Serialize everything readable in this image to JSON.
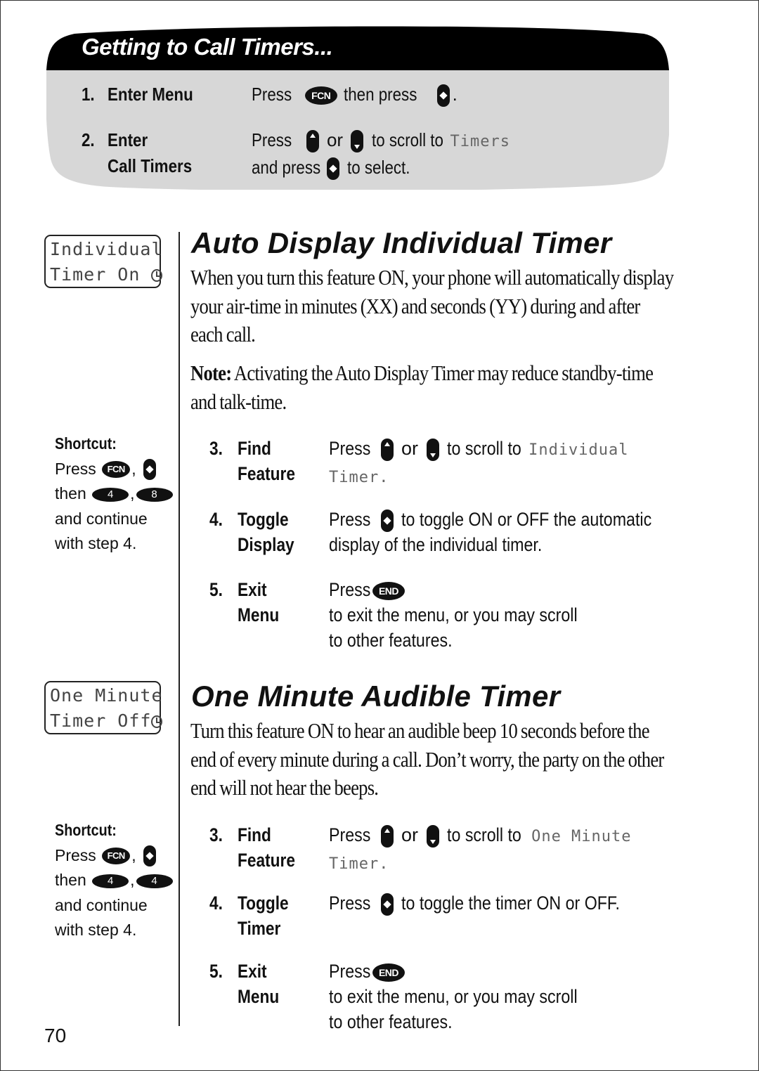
{
  "header": {
    "title": "Getting to Call Timers...",
    "steps": [
      {
        "number": "1.",
        "label": "Enter Menu",
        "desc_parts": [
          "Press",
          "then press",
          "."
        ],
        "keys": [
          "FCN",
          "select"
        ]
      },
      {
        "number": "2.",
        "label_line1": "Enter",
        "label_line2": "Call Timers",
        "line1_parts": [
          "Press",
          "or",
          "to scroll to"
        ],
        "line1_lcd": "Timers",
        "line2_parts": [
          "and press",
          "to select."
        ]
      }
    ]
  },
  "section1": {
    "title": "Auto Display Individual Timer",
    "lcd_line1": "Individual",
    "lcd_line2": "Timer On",
    "lcd_icon": "clock-icon",
    "intro": "When you turn this feature ON, your phone will automatically display your air-time in minutes (XX) and seconds (YY) during and after each call.",
    "note_label": "Note:",
    "note_text": " Activating the Auto Display Timer may reduce standby-time and talk-time.",
    "shortcut": {
      "title": "Shortcut:",
      "press": "Press",
      "comma": ",",
      "then": "then",
      "fcn_key": "FCN",
      "num_keys": [
        "4",
        "8"
      ],
      "line3": "and continue",
      "line4": "with step 4."
    },
    "steps": [
      {
        "number": "3.",
        "label_line1": "Find",
        "label_line2": "Feature",
        "parts": [
          "Press",
          "or",
          "to scroll to"
        ],
        "lcd_a": "Individual",
        "lcd_b": "Timer."
      },
      {
        "number": "4.",
        "label_line1": "Toggle",
        "label_line2": "Display",
        "parts": [
          "Press",
          "to toggle ON or OFF the automatic"
        ],
        "line2": "display of the individual timer."
      },
      {
        "number": "5.",
        "label_line1": "Exit",
        "label_line2": "Menu",
        "parts": [
          "Press",
          "to exit the menu, or you may scroll"
        ],
        "key": "END",
        "line2": "to other features."
      }
    ]
  },
  "section2": {
    "title": "One Minute Audible Timer",
    "lcd_line1": "One Minute",
    "lcd_line2": "Timer Off",
    "lcd_icon": "clock-icon",
    "intro": "Turn this feature ON to hear an audible beep 10 seconds before the end of every minute during a call. Don’t worry, the party on the other end will not hear the beeps.",
    "shortcut": {
      "title": "Shortcut:",
      "press": "Press",
      "comma": ",",
      "then": "then",
      "fcn_key": "FCN",
      "num_keys": [
        "4",
        "4"
      ],
      "line3": "and continue",
      "line4": "with step 4."
    },
    "steps": [
      {
        "number": "3.",
        "label_line1": "Find",
        "label_line2": "Feature",
        "parts": [
          "Press",
          "or",
          "to scroll to"
        ],
        "lcd_a": "One Minute",
        "lcd_b": "Timer."
      },
      {
        "number": "4.",
        "label_line1": "Toggle",
        "label_line2": "Timer",
        "parts": [
          "Press",
          "to toggle the timer ON or OFF."
        ]
      },
      {
        "number": "5.",
        "label_line1": "Exit",
        "label_line2": "Menu",
        "parts": [
          "Press",
          "to exit the menu, or you may scroll"
        ],
        "key": "END",
        "line2": "to other features."
      }
    ]
  },
  "page_number": "70"
}
